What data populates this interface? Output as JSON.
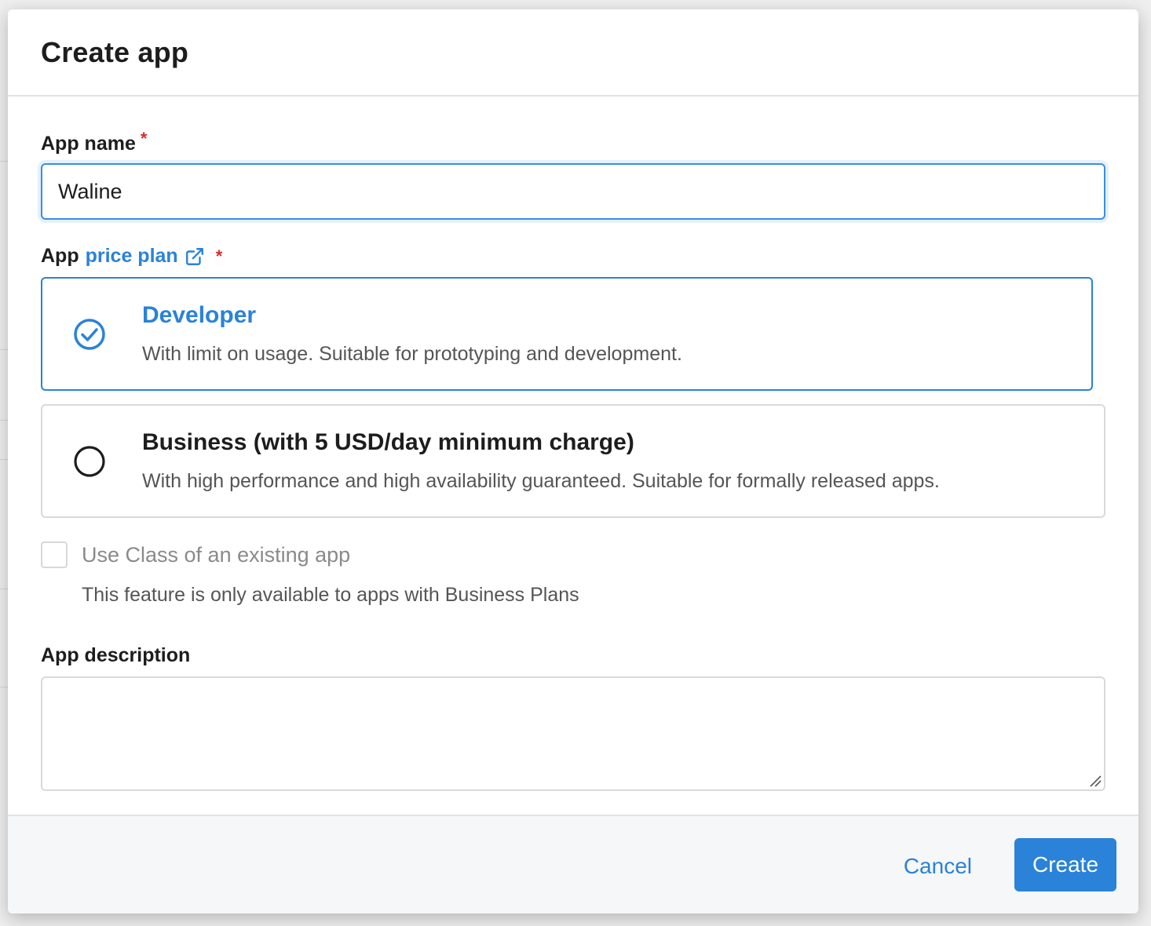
{
  "modal": {
    "title": "Create app"
  },
  "app_name": {
    "label": "App name",
    "required_mark": "*",
    "value": "Waline"
  },
  "price_plan": {
    "label_prefix": "App",
    "link_text": "price plan",
    "required_mark": "*",
    "options": [
      {
        "title": "Developer",
        "description": "With limit on usage. Suitable for prototyping and development.",
        "selected": true
      },
      {
        "title": "Business (with 5 USD/day minimum charge)",
        "description": "With high performance and high availability guaranteed. Suitable for formally released apps.",
        "selected": false
      }
    ]
  },
  "use_class": {
    "label": "Use Class of an existing app",
    "help": "This feature is only available to apps with Business Plans",
    "checked": false
  },
  "app_description": {
    "label": "App description",
    "value": ""
  },
  "footer": {
    "cancel_label": "Cancel",
    "create_label": "Create"
  },
  "colors": {
    "accent": "#2a82d9",
    "required": "#d62c2c"
  }
}
